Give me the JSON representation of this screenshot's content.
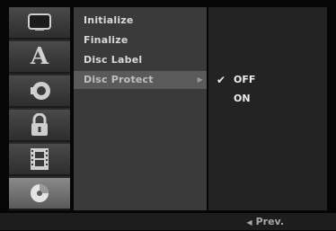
{
  "icons": [
    {
      "name": "display-icon",
      "active": false
    },
    {
      "name": "language-icon",
      "label": "A",
      "active": false
    },
    {
      "name": "audio-icon",
      "active": false
    },
    {
      "name": "lock-icon",
      "active": false
    },
    {
      "name": "recording-icon",
      "active": false
    },
    {
      "name": "disc-icon",
      "active": true
    }
  ],
  "menu": {
    "items": [
      {
        "label": "Initialize",
        "selected": false
      },
      {
        "label": "Finalize",
        "selected": false
      },
      {
        "label": "Disc Label",
        "selected": false
      },
      {
        "label": "Disc Protect",
        "selected": true,
        "arrow": "▶"
      }
    ]
  },
  "submenu": {
    "items": [
      {
        "label": "OFF",
        "checked": true,
        "check": "✔"
      },
      {
        "label": "ON",
        "checked": false,
        "check": ""
      }
    ]
  },
  "footer": {
    "prev_arrow": "◀",
    "prev_label": "Prev."
  }
}
